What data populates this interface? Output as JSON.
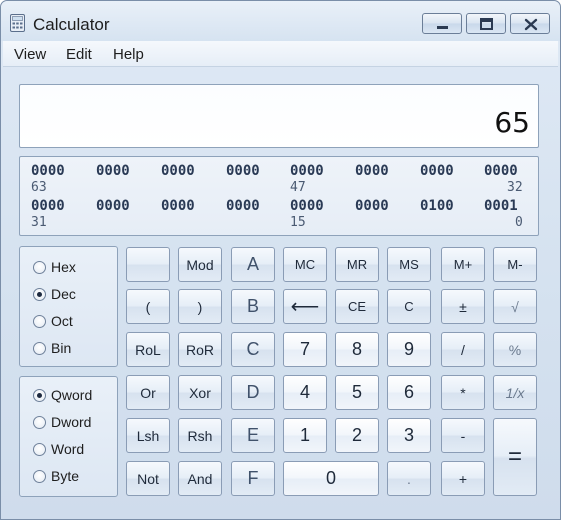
{
  "window": {
    "title": "Calculator"
  },
  "menu": {
    "view": "View",
    "edit": "Edit",
    "help": "Help"
  },
  "display": {
    "value": "65"
  },
  "bits": {
    "row1": [
      "0000",
      "0000",
      "0000",
      "0000",
      "0000",
      "0000",
      "0000",
      "0000"
    ],
    "row1_labels": {
      "left": "63",
      "middle": "47",
      "right": "32"
    },
    "row2": [
      "0000",
      "0000",
      "0000",
      "0000",
      "0000",
      "0000",
      "0100",
      "0001"
    ],
    "row2_labels": {
      "left": "31",
      "middle": "15",
      "right": "0"
    }
  },
  "base": {
    "options": [
      "Hex",
      "Dec",
      "Oct",
      "Bin"
    ],
    "selected": "Dec"
  },
  "word_size": {
    "options": [
      "Qword",
      "Dword",
      "Word",
      "Byte"
    ],
    "selected": "Qword"
  },
  "keys": {
    "blank": "",
    "mod": "Mod",
    "a": "A",
    "mc": "MC",
    "mr": "MR",
    "ms": "MS",
    "mplus": "M+",
    "mminus": "M-",
    "lparen": "(",
    "rparen": ")",
    "b": "B",
    "backspace": "⟵",
    "ce": "CE",
    "c": "C",
    "plusminus": "±",
    "sqrt": "√",
    "rol": "RoL",
    "ror": "RoR",
    "c_hex": "C",
    "seven": "7",
    "eight": "8",
    "nine": "9",
    "divide": "/",
    "percent": "%",
    "or": "Or",
    "xor": "Xor",
    "d": "D",
    "four": "4",
    "five": "5",
    "six": "6",
    "multiply": "*",
    "reciprocal": "1/x",
    "lsh": "Lsh",
    "rsh": "Rsh",
    "e": "E",
    "one": "1",
    "two": "2",
    "three": "3",
    "minus": "-",
    "equals": "=",
    "not": "Not",
    "and": "And",
    "f": "F",
    "zero": "0",
    "dot": ".",
    "plus": "+"
  },
  "colors": {
    "accent": "#8ea2ba",
    "window_bg": "#d4e1ef"
  }
}
